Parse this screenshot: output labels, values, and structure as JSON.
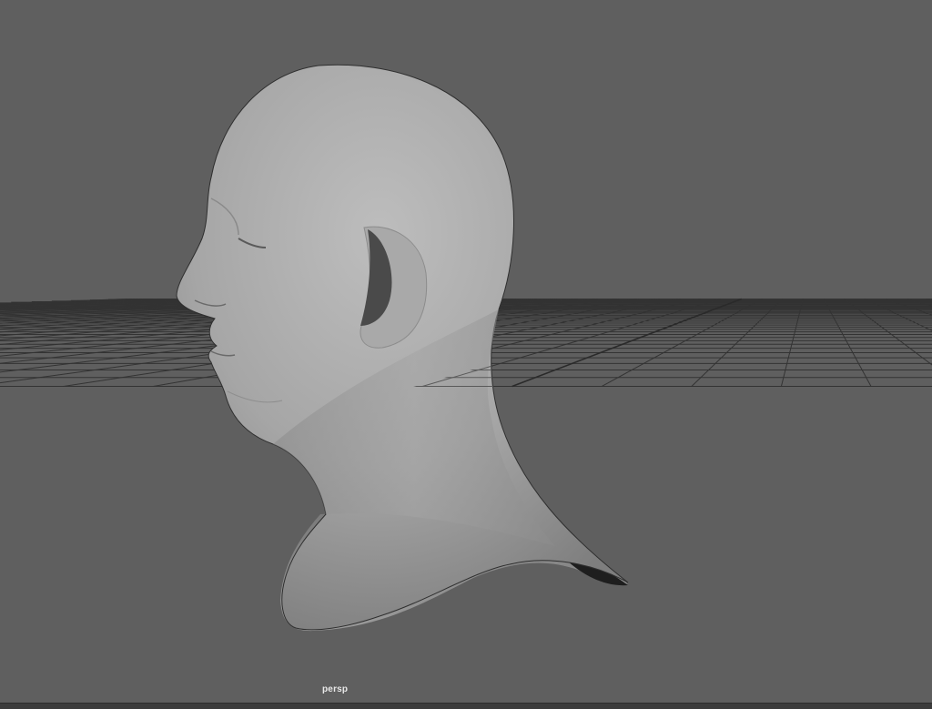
{
  "viewport": {
    "camera_name": "persp",
    "background_color": "#5f5f5f",
    "grid_color": "#333333",
    "grid_axis_color": "#2a2a2a",
    "model": "head-mesh"
  }
}
